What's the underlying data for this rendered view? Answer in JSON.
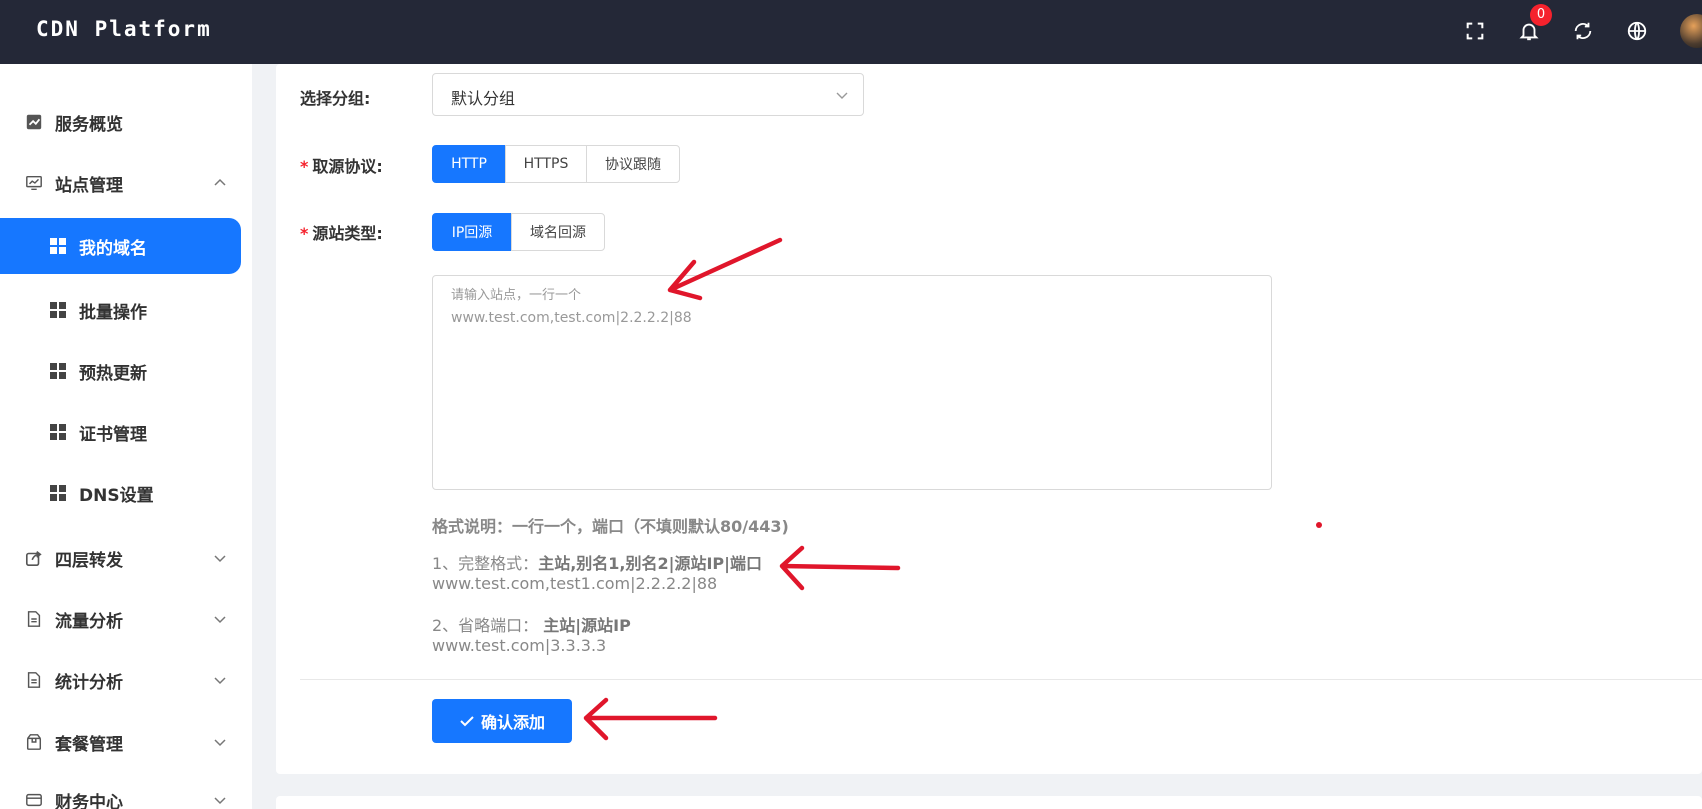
{
  "app": {
    "title": "CDN Platform",
    "notification_count": "0"
  },
  "top_icons": [
    "fullscreen-icon",
    "bell-icon",
    "refresh-icon",
    "globe-icon"
  ],
  "sidebar": {
    "items": [
      {
        "label": "服务概览",
        "icon": "chart-icon"
      },
      {
        "label": "站点管理",
        "icon": "monitor-icon",
        "expanded": true
      },
      {
        "label": "我的域名",
        "sub": true,
        "active": true
      },
      {
        "label": "批量操作",
        "sub": true
      },
      {
        "label": "预热更新",
        "sub": true
      },
      {
        "label": "证书管理",
        "sub": true
      },
      {
        "label": "DNS设置",
        "sub": true
      },
      {
        "label": "四层转发",
        "icon": "share-icon"
      },
      {
        "label": "流量分析",
        "icon": "file-icon"
      },
      {
        "label": "统计分析",
        "icon": "file-icon"
      },
      {
        "label": "套餐管理",
        "icon": "package-icon"
      },
      {
        "label": "财务中心",
        "icon": "card-icon"
      }
    ]
  },
  "form": {
    "group_label": "选择分组:",
    "group_value": "默认分组",
    "protocol_label": "取源协议:",
    "protocol_options": [
      "HTTP",
      "HTTPS",
      "协议跟随"
    ],
    "protocol_selected": "HTTP",
    "origin_label": "源站类型:",
    "origin_options": [
      "IP回源",
      "域名回源"
    ],
    "origin_selected": "IP回源",
    "textarea_placeholder_line1": "请输入站点，一行一个",
    "textarea_placeholder_line2": "www.test.com,test.com|2.2.2.2|88",
    "help_title": "格式说明：一行一个，端口（不填则默认80/443)",
    "help_1_prefix": "1、完整格式：",
    "help_1_format": "主站,别名1,别名2|源站IP|端口",
    "help_1_example": "www.test.com,test1.com|2.2.2.2|88",
    "help_2_prefix": "2、省略端口： ",
    "help_2_format": "主站|源站IP",
    "help_2_example": "www.test.com|3.3.3.3",
    "confirm_label": "确认添加"
  },
  "colors": {
    "primary": "#1677ff",
    "topbar": "#242837",
    "required": "#f5222d",
    "annotation": "#e0162b"
  }
}
